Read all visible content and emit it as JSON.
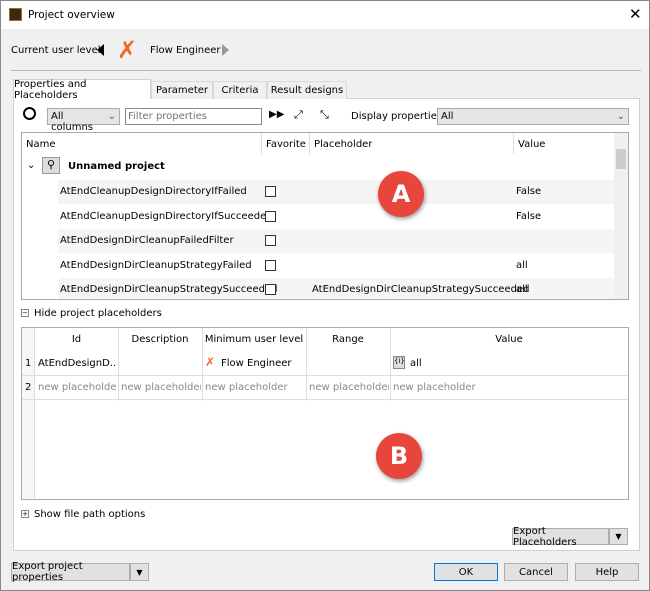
{
  "window": {
    "title": "Project overview",
    "close_icon": "close-icon"
  },
  "user_level": {
    "label": "Current user level",
    "value": "Flow Engineer",
    "accent": "#f26522"
  },
  "tabs": [
    {
      "label": "Properties and Placeholders",
      "active": true
    },
    {
      "label": "Parameter"
    },
    {
      "label": "Criteria"
    },
    {
      "label": "Result designs"
    }
  ],
  "toolbar": {
    "column_select": "All columns",
    "filter_placeholder": "Filter properties",
    "display_label": "Display properties:",
    "display_value": "All"
  },
  "properties_table": {
    "columns": [
      "Name",
      "Favorite",
      "Placeholder",
      "Value"
    ],
    "group": "Unnamed project",
    "rows": [
      {
        "name": "AtEndCleanupDesignDirectoryIfFailed",
        "favorite": false,
        "placeholder": "",
        "value": "False"
      },
      {
        "name": "AtEndCleanupDesignDirectoryIfSucceeded",
        "favorite": false,
        "placeholder": "",
        "value": "False"
      },
      {
        "name": "AtEndDesignDirCleanupFailedFilter",
        "favorite": false,
        "placeholder": "",
        "value": ""
      },
      {
        "name": "AtEndDesignDirCleanupStrategyFailed",
        "favorite": false,
        "placeholder": "",
        "value": "all"
      },
      {
        "name": "AtEndDesignDirCleanupStrategySucceeded",
        "favorite": false,
        "placeholder": "AtEndDesignDirCleanupStrategySucceeded",
        "value": "all"
      }
    ]
  },
  "placeholders": {
    "toggle_label": "Hide project placeholders",
    "columns": [
      "Id",
      "Description",
      "Minimum user level",
      "Range",
      "Value"
    ],
    "rows": [
      {
        "num": "1",
        "id": "AtEndDesignD...",
        "description": "",
        "level": "Flow Engineer",
        "range": "",
        "value": "all"
      },
      {
        "num": "2",
        "id": "new placeholder",
        "description": "new placeholder",
        "level": "new placeholder",
        "range": "new placeholder",
        "value": "new placeholder"
      }
    ]
  },
  "file_path_toggle": "Show file path options",
  "buttons": {
    "export_placeholders": "Export Placeholders",
    "export_properties": "Export project properties",
    "ok": "OK",
    "cancel": "Cancel",
    "help": "Help"
  },
  "annotations": {
    "a": "A",
    "b": "B",
    "color": "#e8453c"
  }
}
